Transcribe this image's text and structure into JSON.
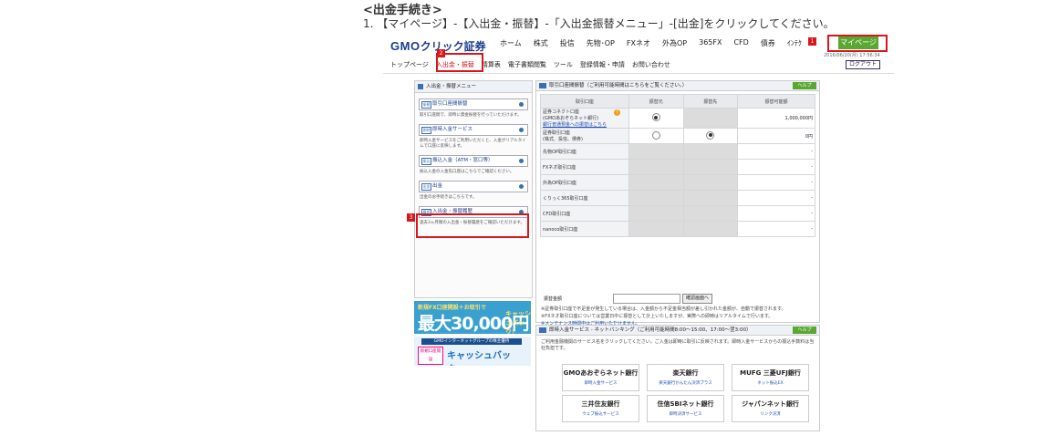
{
  "doc": {
    "heading": "<出金手続き>",
    "step": "1. 【マイページ】-【入出金・振替】-「入出金振替メニュー」-[出金]をクリックしてください。"
  },
  "site": {
    "logo_prefix": "GMO",
    "logo_name": "クリック証券",
    "nav": [
      "ホーム",
      "株式",
      "投信",
      "先物･OP",
      "FXネオ",
      "外為OP",
      "365FX",
      "CFD",
      "債券",
      "ｲﾝﾃｸ"
    ],
    "mypage": "マイページ",
    "datetime": "2016/06/20(月) 17:56:34",
    "logout": "ログアウト",
    "subnav": [
      "トップページ",
      "入出金・振替",
      "精算表",
      "電子書類閲覧",
      "ツール",
      "登録情報・申請",
      "お問い合わせ"
    ],
    "badges": [
      "1",
      "2",
      "3"
    ]
  },
  "left_menu": {
    "title": "入出金・振替メニュー",
    "items": [
      {
        "icon": "振替",
        "label": "取引口座間振替",
        "desc": "取引口座間で、即時に資金振替を行っていただけます。"
      },
      {
        "icon": "即時",
        "label": "即時入金サービス",
        "desc": "即時入金サービスをご利用いただくと、入金がリアルタイムで口座に反映します。"
      },
      {
        "icon": "振込",
        "label": "振込入金（ATM・窓口等）",
        "desc": "振込入金の入金先口座はこちらでご確認ください。"
      },
      {
        "icon": "出金",
        "label": "出金",
        "desc": "出金のお手続きはこちらです。"
      },
      {
        "icon": "履歴",
        "label": "入出金・振替履歴",
        "desc": "過去3ヵ月間の入出金・振替履歴をご確認いただけます。"
      }
    ]
  },
  "banners": {
    "b1_line1": "新規FX口座開設＋お取引で",
    "b1_amount": "最大30,000円",
    "b1_tail": "キャッシュバック！",
    "b2_line1": "GMOインターネットグループの株主優待",
    "b2_badge": "新規口座開設",
    "b2_main": "キャッシュバック!!!"
  },
  "transfer": {
    "title": "取引口座間振替（ご利用可能時間はこちらをご覧ください。）",
    "help": "ヘルプ",
    "headers": [
      "取引口座",
      "振替元",
      "振替先",
      "振替可能額"
    ],
    "rows": [
      {
        "name": "証券コネクト口座\n(GMOあおぞらネット銀行)",
        "link": "銀行普通預金への振替はこちら",
        "amount": "1,000,000円",
        "from": true,
        "to": false
      },
      {
        "name": "証券取引口座\n(株式、投信、債券)",
        "link": "",
        "amount": "0円",
        "from": false,
        "to": true
      },
      {
        "name": "先物OP取引口座",
        "amount": "-"
      },
      {
        "name": "FXネオ取引口座",
        "amount": "-"
      },
      {
        "name": "外為OP取引口座",
        "amount": "-"
      },
      {
        "name": "くりっく365取引口座",
        "amount": "-"
      },
      {
        "name": "CFD取引口座",
        "amount": "-"
      },
      {
        "name": "nanoco取引口座",
        "amount": "-"
      }
    ],
    "amount_label": "振替金額",
    "amount_button": "確認画面へ",
    "notes": [
      "※証券取引口座で不足金が発生している場合は、入金額から不足金相当額が差し引かれた金額が、自動で振替されます。",
      "※FXネオ取引口座については営業日中に振替として計上いたしますが、実際への即時はリアルタイムで行います。",
      "※メンテナンス時間中はご利用いただけません。"
    ]
  },
  "instant": {
    "title": "即時入金サービス - ネットバンキング（ご利用可能時間8:00～15:00、17:00～翌3:00）",
    "help": "ヘルプ",
    "desc": "ご利用金融機関のサービス名をクリックしてください。ご入金は即時に取引に反映されます。即時入金サービスからの振込手数料は当社負担です。",
    "banks": [
      {
        "name": "GMOあおぞらネット銀行",
        "service": "即時入金サービス"
      },
      {
        "name": "楽天銀行",
        "service": "楽天銀行かんたん決済プラス"
      },
      {
        "name": "MUFG 三菱UFJ銀行",
        "service": "ネット振込EX"
      },
      {
        "name": "三井住友銀行",
        "service": "ウェブ振込サービス"
      },
      {
        "name": "住信SBIネット銀行",
        "service": "即時決済サービス"
      },
      {
        "name": "ジャパンネット銀行",
        "service": "リンク決済"
      }
    ]
  }
}
